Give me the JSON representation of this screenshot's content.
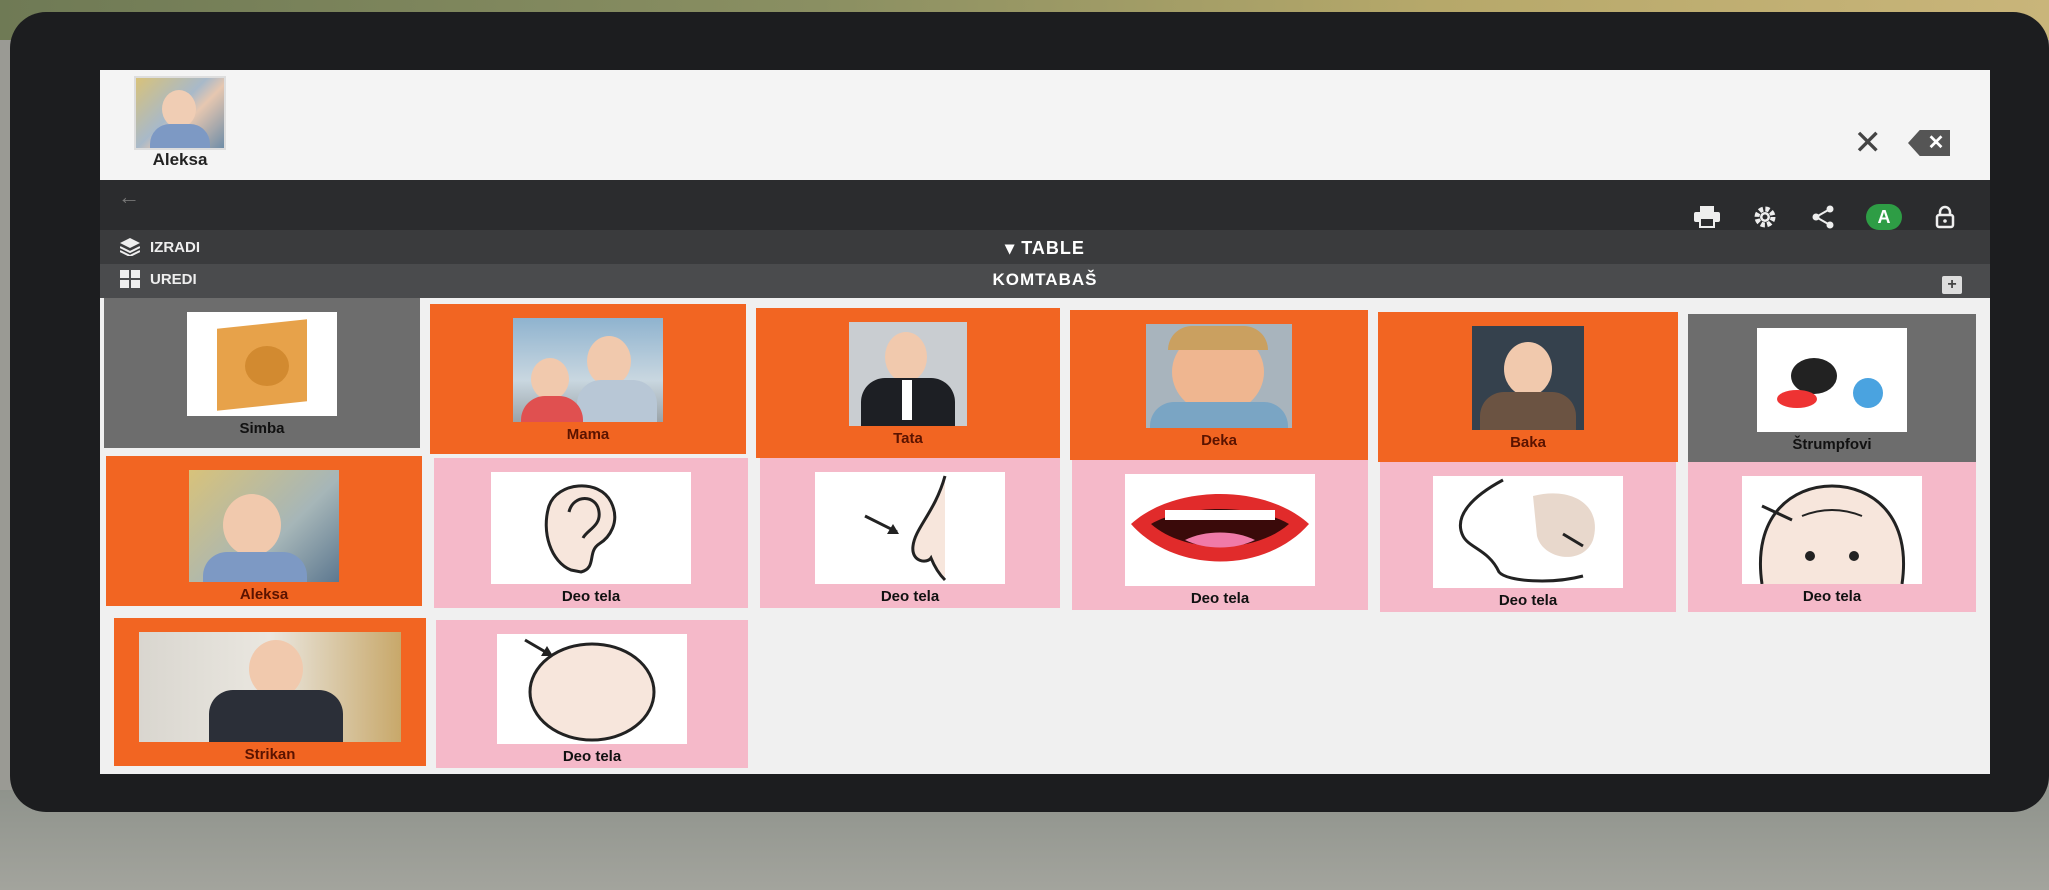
{
  "user": {
    "name": "Aleksa"
  },
  "header": {
    "close_symbol": "✕",
    "backspace_symbol": "✕",
    "back_symbol": "←",
    "toolbar_icons": [
      "print-icon",
      "settings-icon",
      "share-icon",
      "account-avatar",
      "lock-icon"
    ],
    "account_initial": "A"
  },
  "menu": {
    "build_label": "IZRADI",
    "edit_label": "UREDI",
    "table_label": "TABLE",
    "board_title": "KOMTABAŠ",
    "add_symbol": "+"
  },
  "colors": {
    "category_grey": "#6d6d6d",
    "person_orange": "#f26522",
    "body_part_pink": "#f5b9c9",
    "account_green": "#2e9d45"
  },
  "tiles": [
    {
      "label": "Simba",
      "kind": "grey",
      "image": "book-cover"
    },
    {
      "label": "Mama",
      "kind": "orange",
      "image": "photo-mother-child"
    },
    {
      "label": "Tata",
      "kind": "orange",
      "image": "photo-man-suit"
    },
    {
      "label": "Deka",
      "kind": "orange",
      "image": "photo-grandfather"
    },
    {
      "label": "Baka",
      "kind": "orange",
      "image": "photo-grandmother"
    },
    {
      "label": "Štrumpfovi",
      "kind": "grey",
      "image": "cartoon-smurfs"
    },
    {
      "label": "Aleksa",
      "kind": "orange",
      "image": "photo-child"
    },
    {
      "label": "Deo tela",
      "kind": "pink",
      "image": "ear-symbol"
    },
    {
      "label": "Deo tela",
      "kind": "pink",
      "image": "nose-symbol"
    },
    {
      "label": "Deo tela",
      "kind": "pink",
      "image": "mouth-symbol"
    },
    {
      "label": "Deo tela",
      "kind": "pink",
      "image": "cheek-symbol"
    },
    {
      "label": "Deo tela",
      "kind": "pink",
      "image": "forehead-symbol"
    },
    {
      "label": "Strikan",
      "kind": "orange",
      "image": "photo-older-man"
    },
    {
      "label": "Deo tela",
      "kind": "pink",
      "image": "head-symbol"
    }
  ]
}
